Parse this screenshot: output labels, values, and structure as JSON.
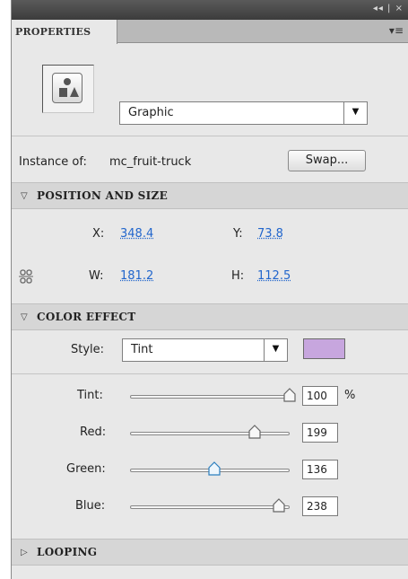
{
  "titlebar": {
    "controls": "◂◂ | ×"
  },
  "tab": {
    "label": "PROPERTIES",
    "menu_icon": "▾≡"
  },
  "symbol": {
    "icon": "graphic-symbol-icon",
    "type": "Graphic"
  },
  "instance": {
    "label": "Instance of:",
    "name": "mc_fruit-truck",
    "swap_label": "Swap..."
  },
  "position_size": {
    "title": "POSITION AND SIZE",
    "x_label": "X:",
    "x": "348.4",
    "y_label": "Y:",
    "y": "73.8",
    "w_label": "W:",
    "w": "181.2",
    "h_label": "H:",
    "h": "112.5",
    "link_icon": "chain-link-icon"
  },
  "color_effect": {
    "title": "COLOR EFFECT",
    "style_label": "Style:",
    "style_value": "Tint",
    "swatch_color": "#c7a6de",
    "sliders": [
      {
        "label": "Tint:",
        "value": "100",
        "unit": "%",
        "fraction": 1.0
      },
      {
        "label": "Red:",
        "value": "199",
        "fraction": 0.78
      },
      {
        "label": "Green:",
        "value": "136",
        "fraction": 0.53
      },
      {
        "label": "Blue:",
        "value": "238",
        "fraction": 0.93
      }
    ]
  },
  "looping": {
    "title": "LOOPING"
  }
}
